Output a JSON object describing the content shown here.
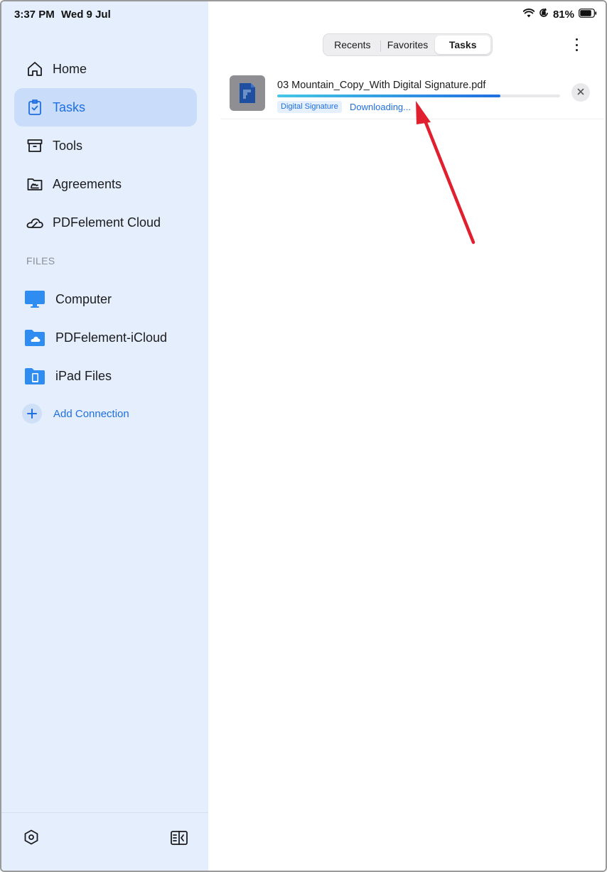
{
  "status_bar": {
    "time": "3:37 PM",
    "date": "Wed 9 Jul",
    "battery": "81%"
  },
  "sidebar": {
    "nav_items": [
      {
        "label": "Home",
        "icon": "home-icon",
        "active": false
      },
      {
        "label": "Tasks",
        "icon": "tasks-clipboard-icon",
        "active": true
      },
      {
        "label": "Tools",
        "icon": "tools-box-icon",
        "active": false
      },
      {
        "label": "Agreements",
        "icon": "agreements-folder-icon",
        "active": false
      },
      {
        "label": "PDFelement Cloud",
        "icon": "cloud-icon",
        "active": false
      }
    ],
    "files_header": "FILES",
    "file_items": [
      {
        "label": "Computer",
        "icon": "computer-monitor-icon"
      },
      {
        "label": "PDFelement-iCloud",
        "icon": "icloud-folder-icon"
      },
      {
        "label": "iPad Files",
        "icon": "ipad-folder-icon"
      }
    ],
    "add_connection": "Add Connection"
  },
  "main": {
    "tabs": [
      {
        "label": "Recents",
        "selected": false
      },
      {
        "label": "Favorites",
        "selected": false
      },
      {
        "label": "Tasks",
        "selected": true
      }
    ],
    "task": {
      "file_name": "03 Mountain_Copy_With Digital Signature.pdf",
      "tag": "Digital Signature",
      "status": "Downloading...",
      "progress": 0.79
    }
  },
  "colors": {
    "accent": "#1f6fe0",
    "sidebar_bg": "#e5eefd",
    "active_bg": "#c9dcfa",
    "progress_start": "#45c6e6",
    "progress_end": "#1f6fe0",
    "arrow": "#e0202e"
  }
}
